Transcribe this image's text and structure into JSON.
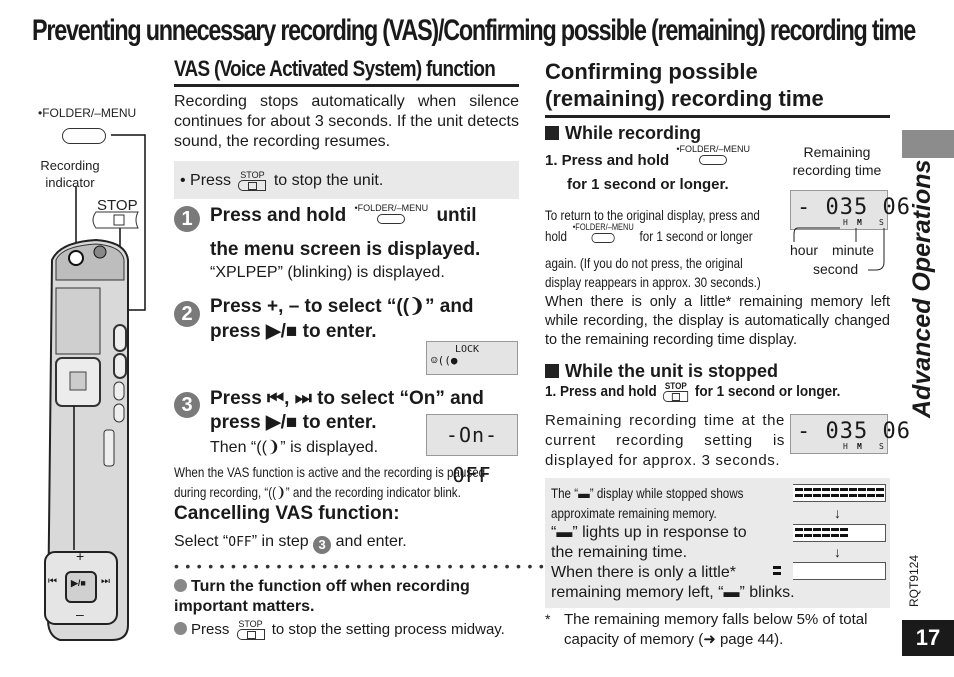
{
  "page_title": "Preventing unnecessary recording (VAS)/Confirming possible (remaining) recording time",
  "illustration": {
    "folder_menu_label": "•FOLDER/–MENU",
    "recording_indicator_label": "Recording indicator",
    "stop_label": "STOP",
    "pad_plus": "+",
    "pad_minus": "–",
    "pad_center": "▶/■",
    "pad_left": "⏮",
    "pad_right": "⏭"
  },
  "vas": {
    "heading": "VAS (Voice Activated System) function",
    "intro": "Recording stops automatically when silence continues for about 3 seconds. If the unit detects sound, the recording resumes.",
    "press_note_prefix": "• Press",
    "press_note_suffix": "to stop the unit.",
    "stop_icon_label": "STOP",
    "steps": [
      {
        "number": "1",
        "line1_prefix": "Press and hold",
        "button_label": "•FOLDER/–MENU",
        "line1_suffix": "until",
        "line2": "the menu screen is displayed.",
        "sub": "“XPLPEP” (blinking) is displayed."
      },
      {
        "number": "2",
        "line1": "Press +, – to select “((❩” and",
        "line2": "press ▶/■ to enter.",
        "lcd_text": "LOCK"
      },
      {
        "number": "3",
        "line1": "Press ⏮, ⏭ to select “On” and",
        "line2": "press ▶/■ to enter.",
        "sub": "Then “((❩” is displayed.",
        "lcd_text": "-On-OFF"
      }
    ],
    "pause_note": "When the VAS function is active and the recording is paused during recording, “((❩” and the recording indicator blink.",
    "cancel_heading": "Cancelling VAS function:",
    "cancel_text_prefix": "Select “",
    "cancel_value": "OFF",
    "cancel_text_mid": "” in step",
    "cancel_step": "3",
    "cancel_text_suffix": "and enter.",
    "tip1": "Turn the function off when recording important matters.",
    "tip2_prefix": "Press",
    "tip2_suffix": "to stop the setting process midway."
  },
  "confirm": {
    "heading_line1": "Confirming possible",
    "heading_line2": "(remaining) recording time",
    "while_recording": {
      "heading": "While recording",
      "step_prefix": "1. Press and hold",
      "button_label": "•FOLDER/–MENU",
      "step_suffix": "for 1 second or longer.",
      "remaining_label": "Remaining recording time",
      "lcd_value": "- 035 06",
      "lcd_units": [
        "H",
        "M",
        "S"
      ],
      "hour_label": "hour",
      "minute_label": "minute",
      "second_label": "second",
      "return_note_1": "To return to the original display, press and",
      "return_note_2_prefix": "hold",
      "return_note_2_suffix": "for 1 second or longer",
      "return_note_3": "again. (If you do not press, the original",
      "return_note_4": "display reappears in approx. 30 seconds.)",
      "little_memory_note": "When there is only a little* remaining memory left while recording, the display is automatically changed to the remaining recording time display."
    },
    "while_stopped": {
      "heading": "While the unit is stopped",
      "step_prefix": "1. Press and hold",
      "stop_icon_label": "STOP",
      "step_suffix": "for 1 second or longer.",
      "desc": "Remaining recording time at the current recording setting is displayed for approx. 3 seconds.",
      "lcd_value": "- 035 06",
      "lcd_units": [
        "H",
        "M",
        "S"
      ]
    },
    "memory_box": {
      "line1": "The “▬” display while stopped shows",
      "line2": "approximate remaining memory.",
      "line3": "“▬” lights up in response to",
      "line4": "the remaining time.",
      "line5": "When there is only a little*",
      "line6": "remaining memory left, “▬” blinks.",
      "bar_levels": [
        1.0,
        0.6,
        0.1
      ]
    },
    "footnote": "The remaining memory falls below 5% of total capacity of memory (➜ page 44).",
    "footnote_mark": "*"
  },
  "sidebar": {
    "section": "Advanced Operations",
    "model_code": "RQT9124",
    "page_number": "17"
  }
}
